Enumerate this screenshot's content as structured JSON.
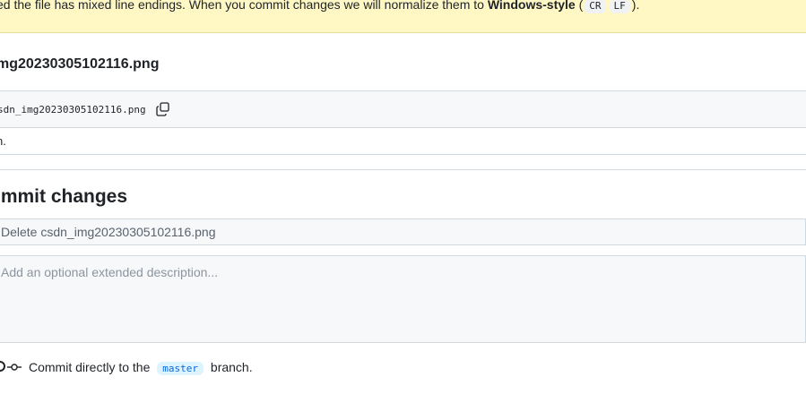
{
  "banner": {
    "text_before": "ed the file has mixed line endings. When you commit changes we will normalize them to ",
    "style_name": "Windows-style",
    "open_paren": " (",
    "kbd_cr": "CR",
    "kbd_lf": "LF",
    "close": ")."
  },
  "file": {
    "title": "mg20230305102116.png",
    "path": "sdn_img20230305102116.png",
    "copy_icon": "copy-icon",
    "body_text": "n."
  },
  "commit": {
    "heading": "ommit changes",
    "summary_value": "",
    "summary_placeholder": "Delete csdn_img20230305102116.png",
    "description_placeholder": "Add an optional extended description...",
    "branch_option": {
      "prefix": "Commit directly to the",
      "branch": "master",
      "suffix": "branch."
    }
  },
  "colors": {
    "banner_bg": "#fff8c5",
    "border": "#d1d9e0",
    "input_bg": "#f6f8fa",
    "branch_accent": "#0969da"
  }
}
